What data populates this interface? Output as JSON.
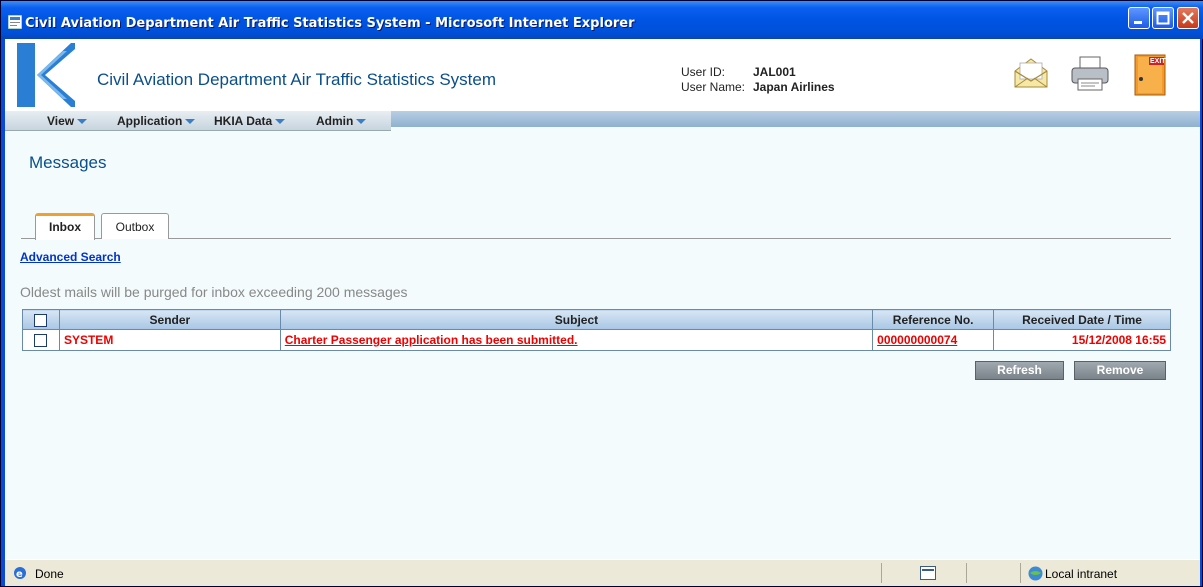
{
  "window": {
    "title": "Civil Aviation Department Air Traffic Statistics System - Microsoft Internet Explorer"
  },
  "header": {
    "app_title": "Civil Aviation Department Air Traffic Statistics System",
    "user_id_label": "User ID:",
    "user_id": "JAL001",
    "user_name_label": "User Name:",
    "user_name": "Japan Airlines",
    "exit_label": "EXIT"
  },
  "menu": {
    "items": [
      {
        "label": "View"
      },
      {
        "label": "Application"
      },
      {
        "label": "HKIA Data"
      },
      {
        "label": "Admin"
      }
    ]
  },
  "page": {
    "title": "Messages",
    "tabs": [
      {
        "label": "Inbox",
        "active": true
      },
      {
        "label": "Outbox",
        "active": false
      }
    ],
    "advanced_search": "Advanced Search",
    "purge_note": "Oldest mails will be purged for inbox exceeding 200 messages"
  },
  "table": {
    "headers": [
      "Sender",
      "Subject",
      "Reference No.",
      "Received Date / Time"
    ],
    "rows": [
      {
        "sender": "SYSTEM",
        "subject": "Charter Passenger application has been submitted.",
        "reference": "000000000074",
        "received": "15/12/2008 16:55"
      }
    ]
  },
  "buttons": {
    "refresh": "Refresh",
    "remove": "Remove"
  },
  "statusbar": {
    "status": "Done",
    "zone": "Local intranet"
  },
  "colors": {
    "accent": "#0a4f8a",
    "link": "#0033cc",
    "unread": "#ee0000"
  }
}
